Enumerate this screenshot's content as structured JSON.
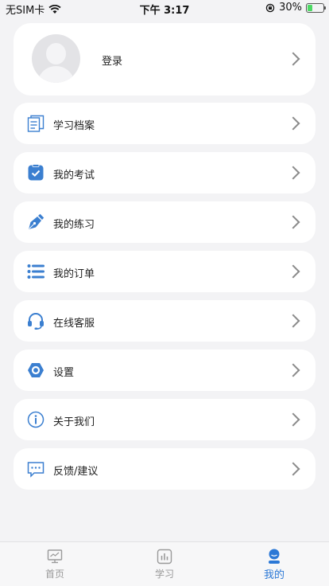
{
  "status_bar": {
    "carrier": "无SIM卡",
    "time": "下午 3:17",
    "battery": "30%",
    "battery_level": 0.3
  },
  "profile": {
    "login_label": "登录"
  },
  "menu": {
    "items": [
      {
        "label": "学习档案",
        "icon": "archive-icon"
      },
      {
        "label": "我的考试",
        "icon": "exam-icon"
      },
      {
        "label": "我的练习",
        "icon": "pen-icon"
      },
      {
        "label": "我的订单",
        "icon": "list-icon"
      },
      {
        "label": "在线客服",
        "icon": "headset-icon"
      },
      {
        "label": "设置",
        "icon": "settings-icon"
      },
      {
        "label": "关于我们",
        "icon": "info-icon"
      },
      {
        "label": "反馈/建议",
        "icon": "feedback-icon"
      }
    ]
  },
  "tabs": [
    {
      "label": "首页",
      "icon": "monitor-icon",
      "active": false
    },
    {
      "label": "学习",
      "icon": "chart-icon",
      "active": false
    },
    {
      "label": "我的",
      "icon": "user-icon",
      "active": true
    }
  ],
  "colors": {
    "accent": "#2b78d6",
    "icon_blue": "#3b7fd0",
    "inactive": "#999999"
  }
}
